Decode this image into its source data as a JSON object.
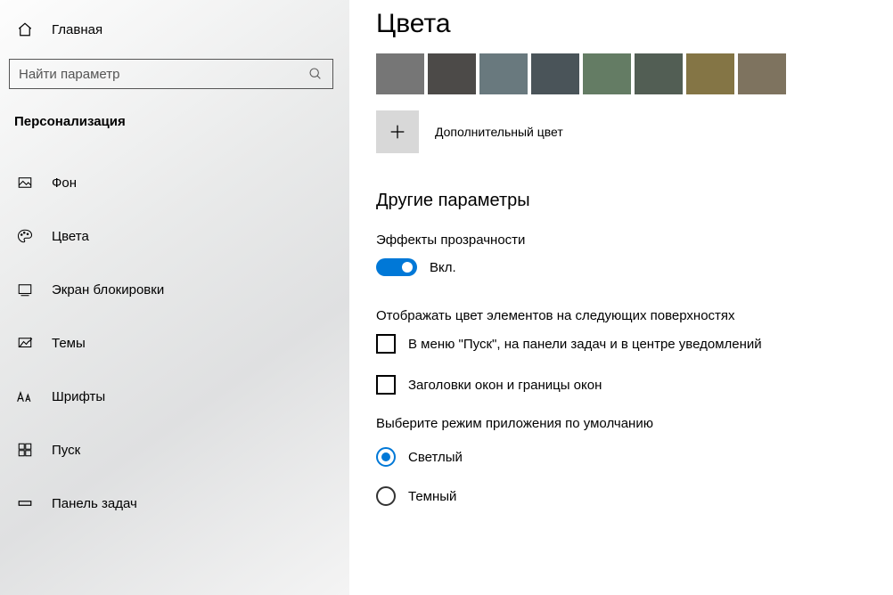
{
  "sidebar": {
    "home_label": "Главная",
    "search_placeholder": "Найти параметр",
    "section_header": "Персонализация",
    "items": [
      {
        "label": "Фон"
      },
      {
        "label": "Цвета"
      },
      {
        "label": "Экран блокировки"
      },
      {
        "label": "Темы"
      },
      {
        "label": "Шрифты"
      },
      {
        "label": "Пуск"
      },
      {
        "label": "Панель задач"
      }
    ]
  },
  "main": {
    "title": "Цвета",
    "swatches": [
      "#767676",
      "#4c4a48",
      "#69797e",
      "#4a5459",
      "#647c64",
      "#525e54",
      "#847545",
      "#7e735f"
    ],
    "add_color_label": "Дополнительный цвет",
    "other_options_heading": "Другие параметры",
    "transparency": {
      "label": "Эффекты прозрачности",
      "state_label": "Вкл.",
      "on": true
    },
    "show_color_label": "Отображать цвет элементов на следующих поверхностях",
    "checkboxes": [
      {
        "label": "В меню \"Пуск\", на панели задач и в центре уведомлений",
        "checked": false
      },
      {
        "label": "Заголовки окон и границы окон",
        "checked": false
      }
    ],
    "app_mode": {
      "group_label": "Выберите режим приложения по умолчанию",
      "options": [
        {
          "label": "Светлый",
          "selected": true
        },
        {
          "label": "Темный",
          "selected": false
        }
      ]
    }
  }
}
